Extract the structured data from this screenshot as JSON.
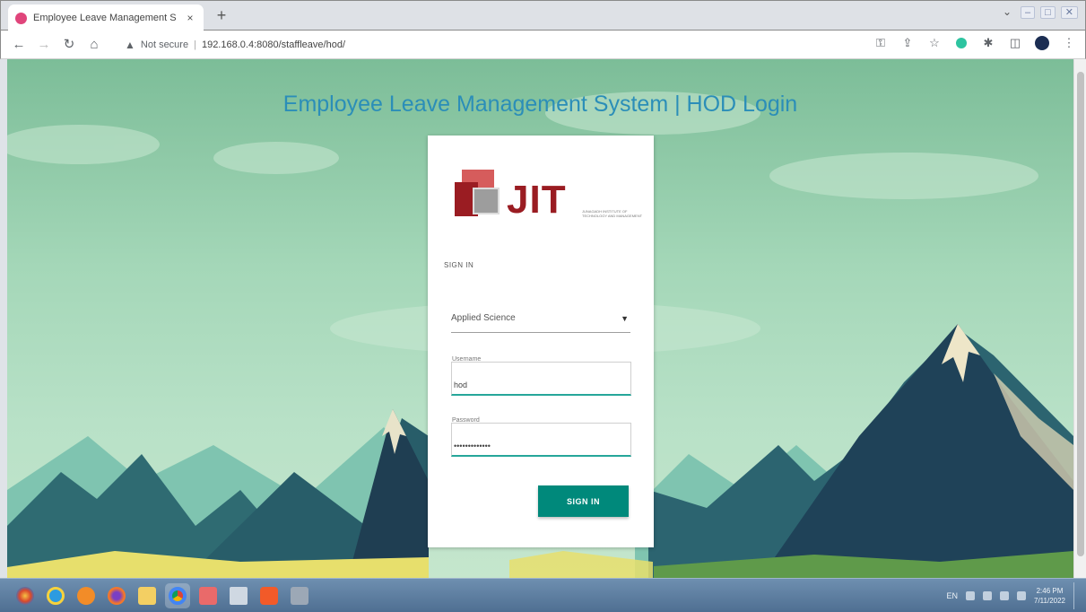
{
  "browser": {
    "tab_title": "Employee Leave Management S",
    "tab_close": "×",
    "new_tab": "+",
    "security_label": "Not secure",
    "url": "192.168.0.4:8080/staffleave/hod/",
    "window_controls": [
      "–",
      "□",
      "✕"
    ]
  },
  "page": {
    "title": "Employee Leave Management System | HOD Login"
  },
  "login": {
    "logo_text": "JIT",
    "logo_tagline": "JUNAGADH INSTITUTE OF TECHNOLOGY AND MANAGEMENT",
    "heading": "SIGN IN",
    "department_selected": "Applied Science",
    "username_label": "Username",
    "username_value": "hod",
    "password_label": "Password",
    "password_value": "•••••••••••••",
    "submit_label": "SIGN IN"
  },
  "taskbar": {
    "language": "EN",
    "time": "2:46 PM",
    "date": "7/11/2022"
  },
  "colors": {
    "accent": "#00897b",
    "title": "#2b8eb8",
    "brand": "#9a1c22"
  }
}
